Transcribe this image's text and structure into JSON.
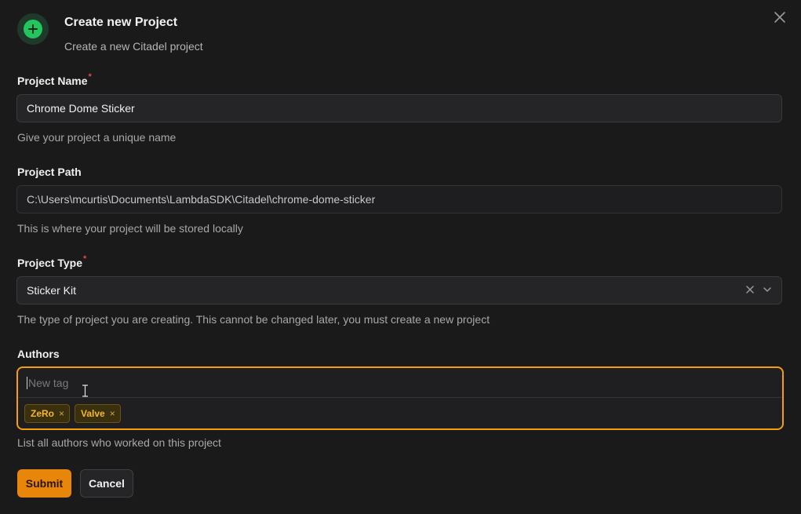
{
  "header": {
    "title": "Create new Project",
    "subtitle": "Create a new Citadel project",
    "icon": "plus-circle-icon",
    "accent": "#22c55e"
  },
  "close_icon": "close-icon",
  "fields": {
    "project_name": {
      "label": "Project Name",
      "required_mark": "*",
      "value": "Chrome Dome Sticker",
      "help": "Give your project a unique name"
    },
    "project_path": {
      "label": "Project Path",
      "value": "C:\\Users\\mcurtis\\Documents\\LambdaSDK\\Citadel\\chrome-dome-sticker",
      "help": "This is where your project will be stored locally"
    },
    "project_type": {
      "label": "Project Type",
      "required_mark": "*",
      "value": "Sticker Kit",
      "help": "The type of project you are creating. This cannot be changed later, you must create a new project"
    },
    "authors": {
      "label": "Authors",
      "placeholder": "New tag",
      "tags": [
        "ZeRo",
        "Valve"
      ],
      "tag_remove": "×",
      "help": "List all authors who worked on this project",
      "focus_color": "#f59e0b"
    }
  },
  "buttons": {
    "submit": "Submit",
    "cancel": "Cancel",
    "submit_color": "#e8860b"
  }
}
